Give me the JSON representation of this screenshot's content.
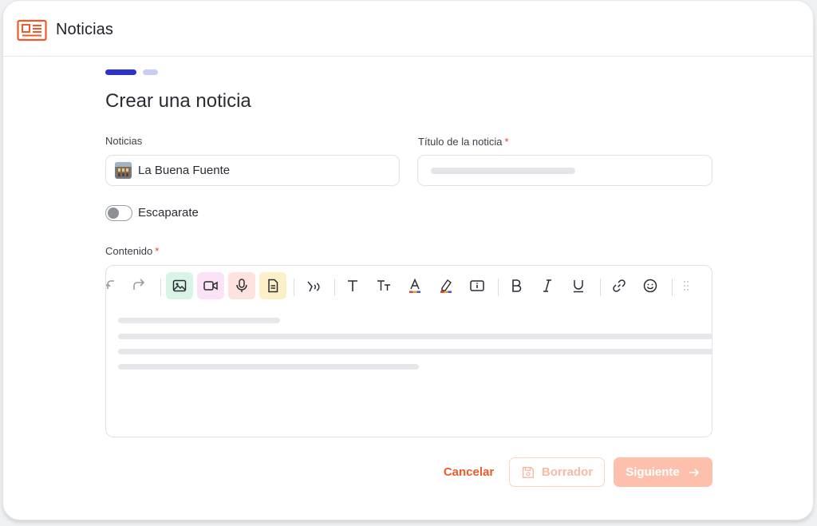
{
  "header": {
    "title": "Noticias",
    "icon": "newspaper-icon",
    "accent": "#f05a28"
  },
  "steps": {
    "total": 2,
    "current": 1
  },
  "form": {
    "page_title": "Crear una noticia",
    "news_label": "Noticias",
    "news_value": "La Buena Fuente",
    "title_label": "Título de la noticia",
    "required_mark": "*",
    "showcase_label": "Escaparate",
    "showcase_on": false,
    "content_label": "Contenido"
  },
  "toolbar": {
    "items": [
      "undo-icon",
      "redo-icon",
      "image-icon",
      "video-icon",
      "microphone-icon",
      "document-icon",
      "voice-icon",
      "text-icon",
      "text-size-icon",
      "font-color-icon",
      "highlight-icon",
      "info-box-icon",
      "bold-icon",
      "italic-icon",
      "underline-icon",
      "link-icon",
      "emoji-icon",
      "list-icon"
    ]
  },
  "footer": {
    "cancel_label": "Cancelar",
    "draft_label": "Borrador",
    "next_label": "Siguiente"
  }
}
